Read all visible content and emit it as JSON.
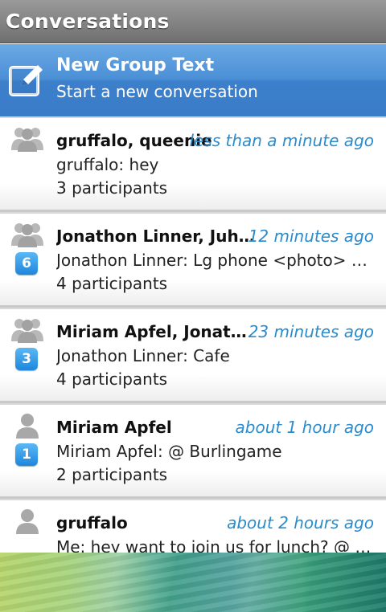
{
  "header": {
    "title": "Conversations"
  },
  "new_group": {
    "title": "New Group Text",
    "subtitle": "Start a new conversation",
    "icon": "compose-icon"
  },
  "conversations": [
    {
      "name": "gruffalo, queenie",
      "time": "less than a minute ago",
      "message": "gruffalo: hey",
      "participants": "3 participants",
      "badge": "",
      "avatar": "group-avatar-icon"
    },
    {
      "name": "Jonathon Linner, Juho-...",
      "time": "12 minutes ago",
      "message": "Jonathon Linner: Lg phone <photo> @ Fi...",
      "participants": "4 participants",
      "badge": "6",
      "avatar": "group-avatar-icon"
    },
    {
      "name": "Miriam Apfel, Jonathon...",
      "time": "23 minutes ago",
      "message": "Jonathon Linner: Cafe",
      "participants": "4 participants",
      "badge": "3",
      "avatar": "group-avatar-icon"
    },
    {
      "name": "Miriam Apfel",
      "time": "about 1 hour ago",
      "message": "Miriam Apfel:  @ Burlingame",
      "participants": "2 participants",
      "badge": "1",
      "avatar": "person-avatar-icon"
    },
    {
      "name": "gruffalo",
      "time": "about 2 hours ago",
      "message": "Me: hey want to join us for lunch? @ Min...",
      "participants": "",
      "badge": "",
      "avatar": "person-avatar-icon"
    }
  ]
}
